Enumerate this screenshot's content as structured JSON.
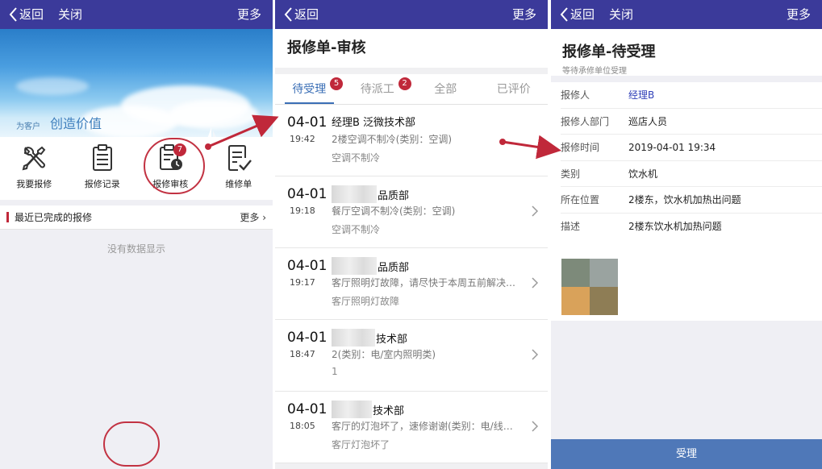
{
  "p1": {
    "nav": {
      "back": "返回",
      "close": "关闭",
      "more": "更多"
    },
    "banner": {
      "slogan_small": "为客户",
      "slogan_big": "创造价值"
    },
    "quick": [
      {
        "label": "我要报修",
        "icon": "wrench-screwdriver-icon"
      },
      {
        "label": "报修记录",
        "icon": "clipboard-list-icon"
      },
      {
        "label": "报修审核",
        "icon": "clipboard-clock-icon",
        "badge": "7"
      },
      {
        "label": "维修单",
        "icon": "clipboard-check-icon"
      }
    ],
    "recent": {
      "title": "最近已完成的报修",
      "more": "更多",
      "empty": "没有数据显示"
    }
  },
  "p2": {
    "nav": {
      "back": "返回",
      "more": "更多"
    },
    "title": "报修单-审核",
    "tabs": [
      {
        "label": "待受理",
        "badge": "5"
      },
      {
        "label": "待派工",
        "badge": "2"
      },
      {
        "label": "全部"
      },
      {
        "label": "已评价"
      }
    ],
    "orders": [
      {
        "date": "04-01",
        "time": "19:42",
        "dept": "经理B 泛微技术部",
        "desc": "2楼空调不制冷(类别：空调)",
        "sub": "空调不制冷"
      },
      {
        "date": "04-01",
        "time": "19:18",
        "dept": "品质部",
        "desc": "餐厅空调不制冷(类别：空调)",
        "sub": "空调不制冷"
      },
      {
        "date": "04-01",
        "time": "19:17",
        "dept": "品质部",
        "desc": "客厅照明灯故障，请尽快于本周五前解决…",
        "sub": "客厅照明灯故障"
      },
      {
        "date": "04-01",
        "time": "18:47",
        "dept": "技术部",
        "desc": "2(类别：电/室内照明类)",
        "sub": "1"
      },
      {
        "date": "04-01",
        "time": "18:05",
        "dept": "技术部",
        "desc": "客厅的灯泡坏了，速修谢谢(类别：电/线…",
        "sub": "客厅灯泡坏了"
      }
    ]
  },
  "p3": {
    "nav": {
      "back": "返回",
      "close": "关闭",
      "more": "更多"
    },
    "title": "报修单-待受理",
    "subtitle": "等待承修单位受理",
    "fields": [
      {
        "k": "报修人",
        "v": "经理B"
      },
      {
        "k": "报修人部门",
        "v": "巡店人员"
      },
      {
        "k": "报修时间",
        "v": "2019-04-01 19:34"
      },
      {
        "k": "类别",
        "v": "饮水机"
      },
      {
        "k": "所在位置",
        "v": "2楼东，饮水机加热出问题"
      },
      {
        "k": "描述",
        "v": "2楼东饮水机加热问题"
      }
    ],
    "accept": "受理"
  },
  "colors": {
    "navbar": "#3b3a9a",
    "accent": "#3b6fb6",
    "badge": "#c0283a",
    "button": "#4f78b8",
    "annotation": "#c23242"
  }
}
